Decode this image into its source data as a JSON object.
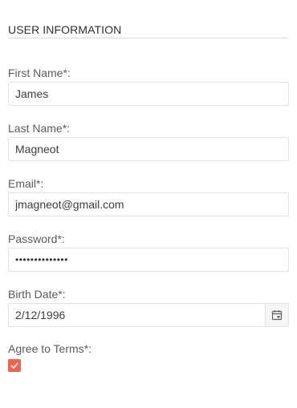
{
  "section": {
    "title": "USER INFORMATION"
  },
  "fields": {
    "first_name": {
      "label": "First Name*:",
      "value": "James"
    },
    "last_name": {
      "label": "Last Name*:",
      "value": "Magneot"
    },
    "email": {
      "label": "Email*:",
      "value": "jmagneot@gmail.com"
    },
    "password": {
      "label": "Password*:",
      "value": "••••••••••••••"
    },
    "birth_date": {
      "label": "Birth Date*:",
      "value": "2/12/1996"
    },
    "terms": {
      "label": "Agree to Terms*:",
      "checked": true
    }
  },
  "icons": {
    "calendar": "calendar-icon",
    "checkmark": "checkmark-icon"
  },
  "colors": {
    "accent": "#f2624f",
    "border": "#e3e3e3",
    "text": "#424242"
  }
}
